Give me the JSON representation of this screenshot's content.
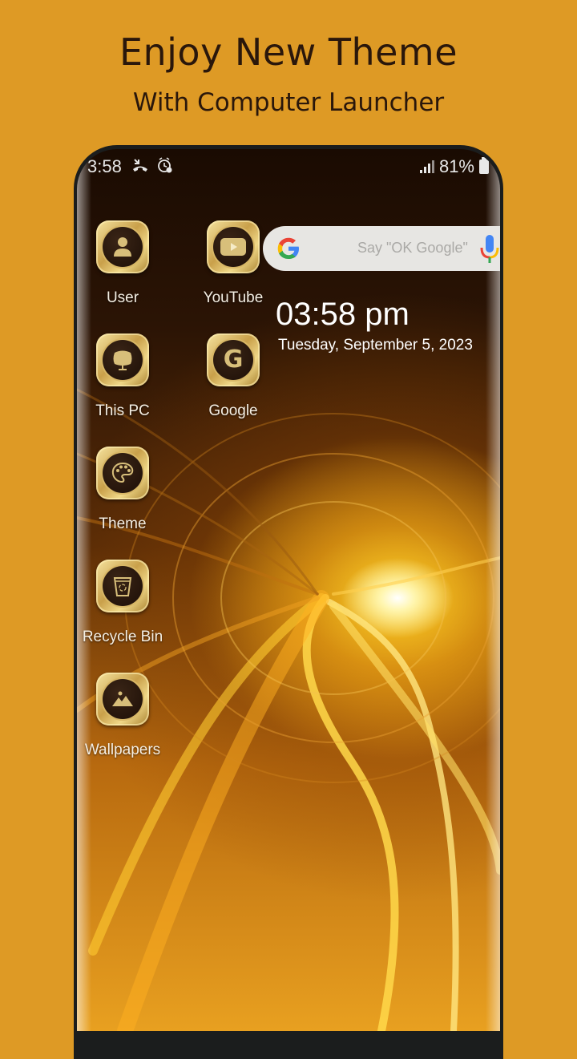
{
  "promo": {
    "title": "Enjoy New Theme",
    "subtitle": "With Computer Launcher"
  },
  "status_bar": {
    "time": "3:58",
    "left_icons": [
      "missed-call-icon",
      "alarm-icon"
    ],
    "battery": "81%",
    "right_icons": [
      "signal-icon",
      "battery-charging-icon"
    ]
  },
  "apps": [
    {
      "label": "User",
      "icon": "user-icon"
    },
    {
      "label": "YouTube",
      "icon": "youtube-icon"
    },
    {
      "label": "This PC",
      "icon": "monitor-icon"
    },
    {
      "label": "Google",
      "icon": "google-g-icon"
    },
    {
      "label": "Theme",
      "icon": "palette-icon"
    },
    {
      "label": "Recycle Bin",
      "icon": "recycle-bin-icon"
    },
    {
      "label": "Wallpapers",
      "icon": "image-icon"
    }
  ],
  "search_widget": {
    "placeholder": "Say \"OK Google\""
  },
  "clock_widget": {
    "time": "03:58 pm",
    "date": "Tuesday, September 5, 2023"
  },
  "colors": {
    "background": "#DE9A25",
    "gold": "#D8B766",
    "dark_disc": "#1D0F07"
  }
}
